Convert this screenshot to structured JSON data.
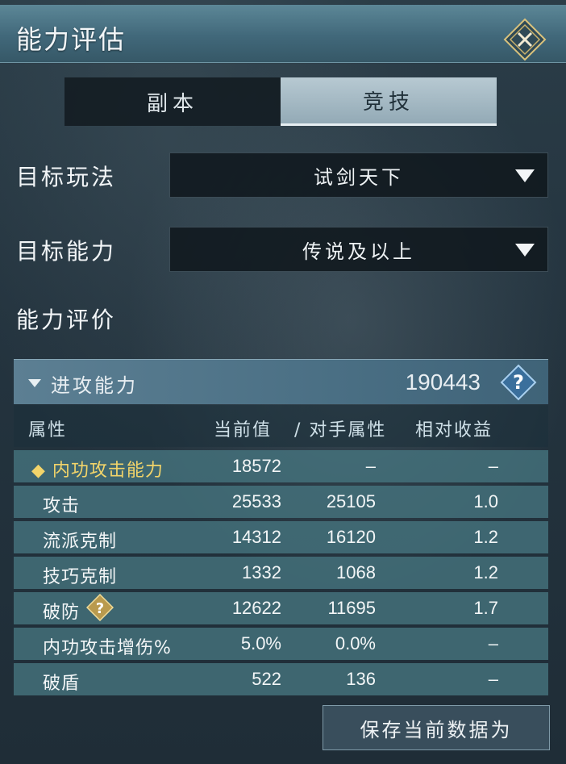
{
  "window": {
    "title": "能力评估"
  },
  "tabs": [
    {
      "label": "副本",
      "active": false
    },
    {
      "label": "竞技",
      "active": true
    }
  ],
  "filters": {
    "mode": {
      "label": "目标玩法",
      "value": "试剑天下"
    },
    "ability": {
      "label": "目标能力",
      "value": "传说及以上"
    }
  },
  "evaluation": {
    "label": "能力评价"
  },
  "section": {
    "title": "进攻能力",
    "score": "190443"
  },
  "table": {
    "headers": [
      "属性",
      "当前值",
      "/ 对手属性",
      "相对收益"
    ],
    "rows": [
      {
        "name": "◆ 内功攻击能力",
        "current": "18572",
        "opponent": "–",
        "gain": "–"
      },
      {
        "name": "攻击",
        "current": "25533",
        "opponent": "25105",
        "gain": "1.0"
      },
      {
        "name": "流派克制",
        "current": "14312",
        "opponent": "16120",
        "gain": "1.2"
      },
      {
        "name": "技巧克制",
        "current": "1332",
        "opponent": "1068",
        "gain": "1.2"
      },
      {
        "name": "破防",
        "current": "12622",
        "opponent": "11695",
        "gain": "1.7"
      },
      {
        "name": "内功攻击增伤%",
        "current": "5.0%",
        "opponent": "0.0%",
        "gain": "–"
      },
      {
        "name": "破盾",
        "current": "522",
        "opponent": "136",
        "gain": "–"
      }
    ]
  },
  "actions": {
    "save_label": "保存当前数据为"
  },
  "colors": {
    "titlebar": "#41687a",
    "highlight_text": "#f2d46a",
    "row_bg": "#467680"
  }
}
